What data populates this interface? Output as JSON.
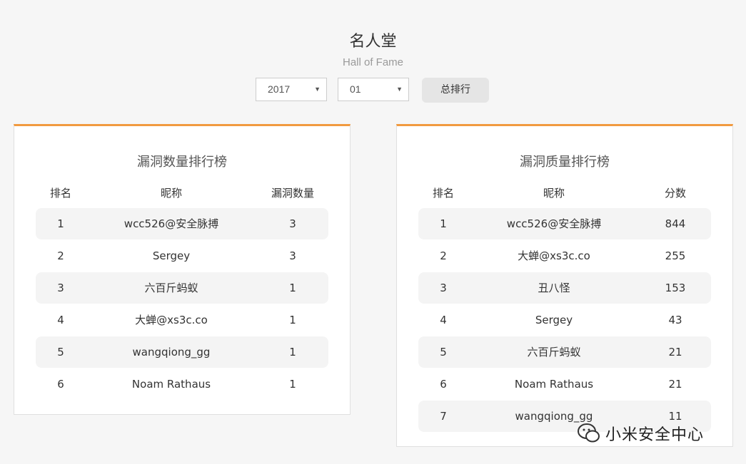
{
  "header": {
    "title": "名人堂",
    "subtitle": "Hall of Fame"
  },
  "filters": {
    "year_value": "2017",
    "month_value": "01",
    "total_button": "总排行"
  },
  "left_table": {
    "title": "漏洞数量排行榜",
    "columns": [
      "排名",
      "昵称",
      "漏洞数量"
    ],
    "rows": [
      [
        "1",
        "wcc526@安全脉搏",
        "3"
      ],
      [
        "2",
        "Sergey",
        "3"
      ],
      [
        "3",
        "六百斤蚂蚁",
        "1"
      ],
      [
        "4",
        "大蝉@xs3c.co",
        "1"
      ],
      [
        "5",
        "wangqiong_gg",
        "1"
      ],
      [
        "6",
        "Noam Rathaus",
        "1"
      ]
    ]
  },
  "right_table": {
    "title": "漏洞质量排行榜",
    "columns": [
      "排名",
      "昵称",
      "分数"
    ],
    "rows": [
      [
        "1",
        "wcc526@安全脉搏",
        "844"
      ],
      [
        "2",
        "大蝉@xs3c.co",
        "255"
      ],
      [
        "3",
        "丑八怪",
        "153"
      ],
      [
        "4",
        "Sergey",
        "43"
      ],
      [
        "5",
        "六百斤蚂蚁",
        "21"
      ],
      [
        "6",
        "Noam Rathaus",
        "21"
      ],
      [
        "7",
        "wangqiong_gg",
        "11"
      ]
    ]
  },
  "watermark": {
    "text": "小米安全中心",
    "icon": "wechat-icon"
  },
  "colors": {
    "accent": "#f19a40",
    "row_shade": "#f4f4f4",
    "background": "#f6f6f6"
  }
}
